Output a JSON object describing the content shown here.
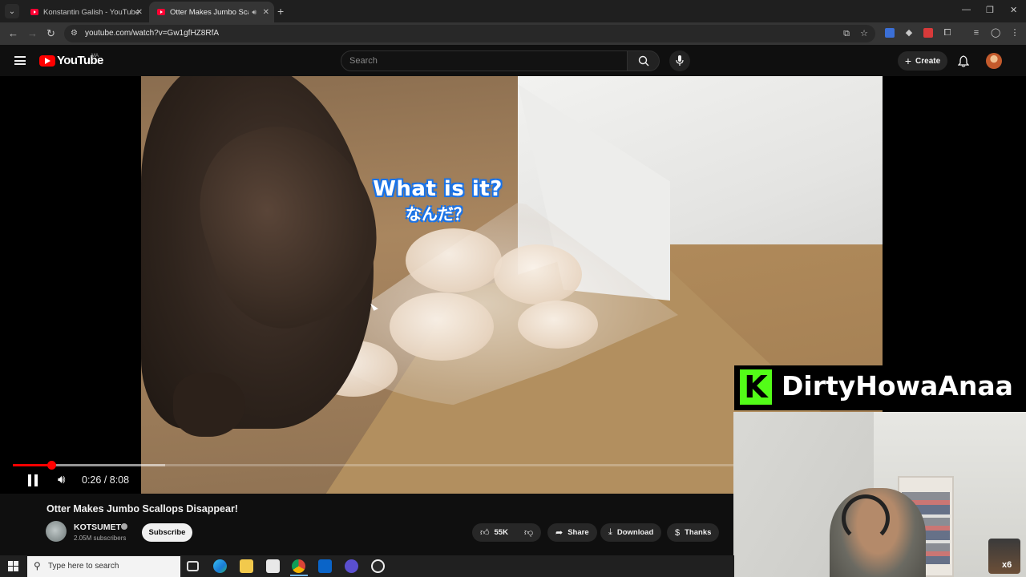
{
  "browser": {
    "tabs": [
      {
        "title": "Konstantin Galish - YouTube",
        "active": false
      },
      {
        "title": "Otter Makes Jumbo Scallop",
        "active": true
      }
    ],
    "url": "youtube.com/watch?v=Gw1gfHZ8RfA"
  },
  "youtube": {
    "logo_text": "YouTube",
    "country_code": "MA",
    "search_placeholder": "Search",
    "create_label": "Create"
  },
  "player": {
    "subtitle_en": "What is it?",
    "subtitle_jp": "なんだ？",
    "current_time": "0:26",
    "duration": "8:08",
    "time_display": "0:26 / 8:08",
    "progress_fraction": 0.0533,
    "buffered_fraction": 0.21,
    "state": "playing"
  },
  "video_info": {
    "title": "Otter Makes Jumbo Scallops Disappear!",
    "channel": "KOTSUMET",
    "subscribers": "2.05M subscribers",
    "subscribe_label": "Subscribe",
    "likes": "55K",
    "share_label": "Share",
    "download_label": "Download",
    "thanks_label": "Thanks"
  },
  "overlay": {
    "kick_logo_letter": "K",
    "streamer_name": "DirtyHowaAnaa",
    "cam_corner_text": "x6"
  },
  "taskbar": {
    "search_placeholder": "Type here to search"
  },
  "colors": {
    "youtube_red": "#ff0000",
    "kick_green": "#53fc18",
    "subtitle_outline": "#1a73e8"
  }
}
